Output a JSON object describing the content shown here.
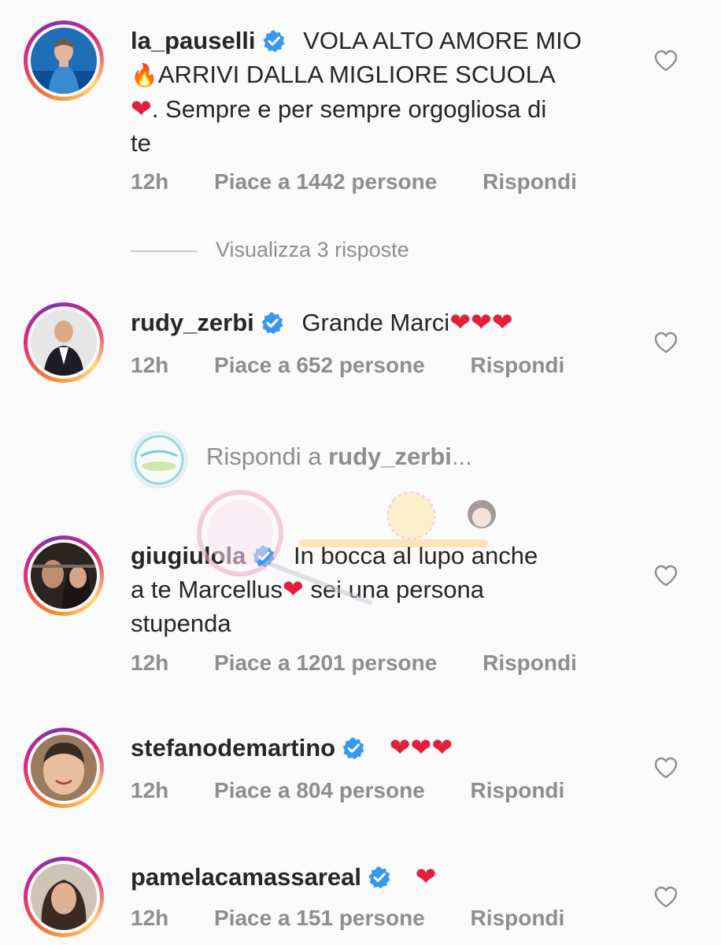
{
  "comments": [
    {
      "username": "la_pauselli",
      "verified": true,
      "text_line1": "VOLA ALTO AMORE MIO",
      "text_line2": "ARRIVI DALLA MIGLIORE SCUOLA",
      "text_line3": ". Sempre e per sempre orgogliosa di",
      "text_line4": "te",
      "time": "12h",
      "likes": "Piace a 1442 persone",
      "reply": "Rispondi",
      "view_replies": "Visualizza 3 risposte"
    },
    {
      "username": "rudy_zerbi",
      "verified": true,
      "text": "Grande Marci",
      "hearts": "❤❤❤",
      "time": "12h",
      "likes": "Piace a 652 persone",
      "reply": "Rispondi"
    },
    {
      "username": "giugiulola",
      "verified": true,
      "text_line1": "In bocca al lupo anche",
      "text_line2a": "a te Marcellus",
      "text_line2b": " sei una persona",
      "text_line3": "stupenda",
      "time": "12h",
      "likes": "Piace a 1201 persone",
      "reply": "Rispondi"
    },
    {
      "username": "stefanodemartino",
      "verified": true,
      "hearts": "❤❤❤",
      "time": "12h",
      "likes": "Piace a 804 persone",
      "reply": "Rispondi"
    },
    {
      "username": "pamelacamassareal",
      "verified": true,
      "hearts": "❤",
      "time": "12h",
      "likes": "Piace a 151 persone",
      "reply": "Rispondi"
    }
  ],
  "reply_box": {
    "prefix": "Rispondi a ",
    "username": "rudy_zerbi",
    "suffix": "..."
  },
  "icons": {
    "like": "heart-outline-icon",
    "verified": "verified-badge-icon",
    "fire": "fire-emoji-icon",
    "red_heart": "red-heart-emoji-icon"
  },
  "colors": {
    "background": "#fafafa",
    "text": "#262626",
    "muted": "#8e8e8e",
    "verified": "#3897f0",
    "heart": "#e3203b"
  }
}
